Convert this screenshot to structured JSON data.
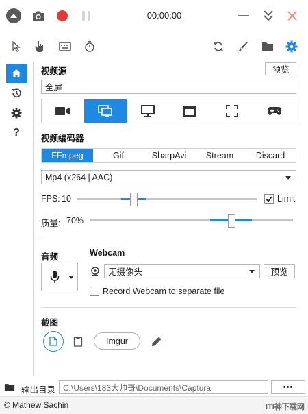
{
  "titlebar": {
    "timer": "00:00:00"
  },
  "source": {
    "label": "视频源",
    "preview_button": "预览",
    "selected_value": "全屏"
  },
  "encoder": {
    "label": "视频编码器",
    "tabs": [
      "FFmpeg",
      "Gif",
      "SharpAvi",
      "Stream",
      "Discard"
    ],
    "codec_selected": "Mp4 (x264 | AAC)"
  },
  "fps": {
    "label": "FPS:",
    "value": "10",
    "limit_label": "Limit",
    "limit_checked": true
  },
  "quality": {
    "label": "质量:",
    "value": "70%"
  },
  "audio": {
    "label": "音频"
  },
  "webcam": {
    "label": "Webcam",
    "camera_selected": "无摄像头",
    "preview_button": "预览",
    "separate_label": "Record Webcam to separate file",
    "separate_checked": false
  },
  "screenshot": {
    "label": "截图",
    "imgur_label": "Imgur"
  },
  "output": {
    "label": "输出目录",
    "path": "C:\\Users\\183大帅哥\\Documents\\Captura",
    "more_label": "•••"
  },
  "footer": {
    "credit": "© Mathew Sachin",
    "watermark": "ITI神下载网"
  },
  "colors": {
    "accent": "#1e88e5",
    "record_red": "#e53935"
  }
}
